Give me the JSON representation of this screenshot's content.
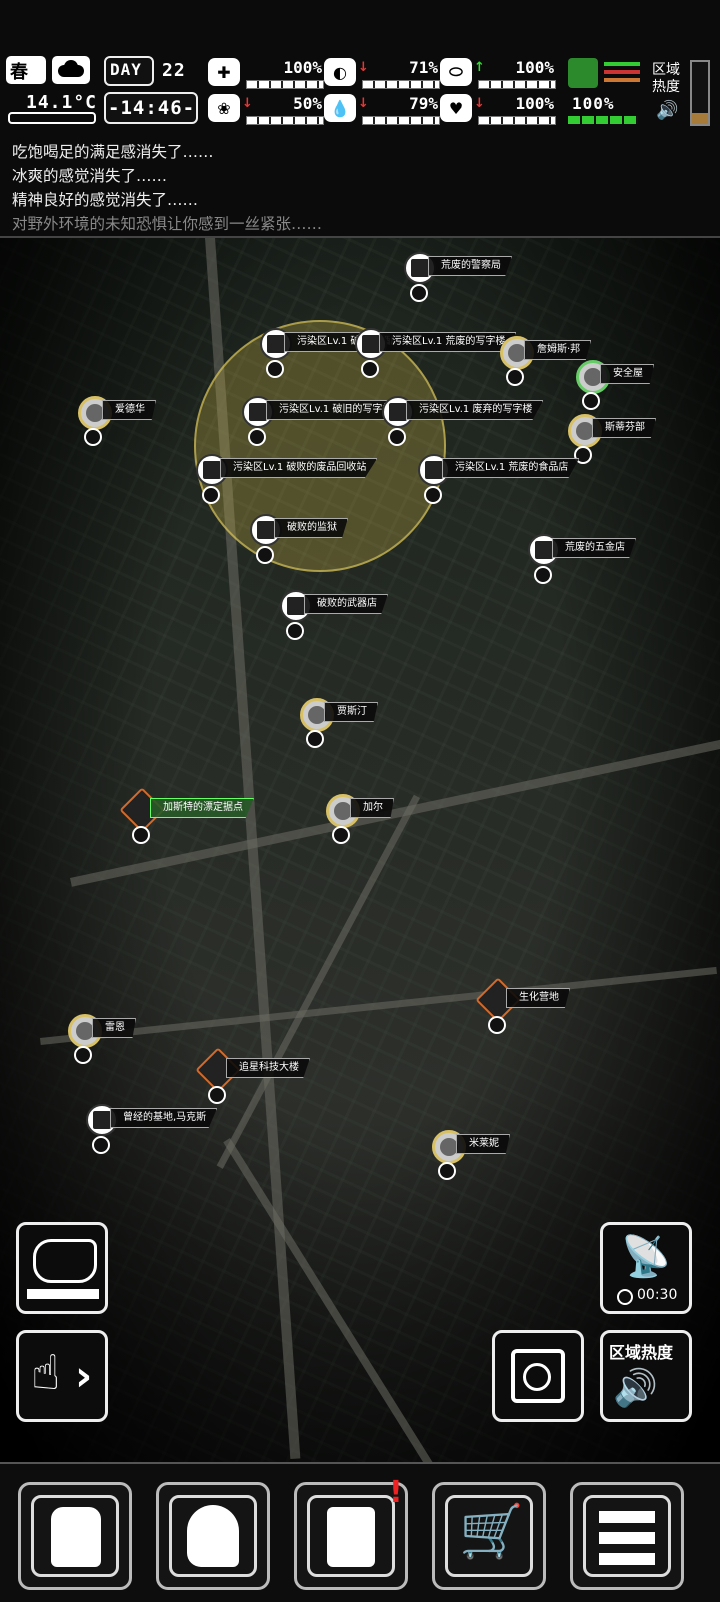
{
  "hud": {
    "season": "春",
    "temperature": "14.1°C",
    "day_label": "DAY",
    "day_number": "22",
    "clock": "-14:46-",
    "stats": [
      {
        "icon": "medkit-icon",
        "value": "100%",
        "level": 1.0
      },
      {
        "icon": "stomach-icon",
        "value": "71%",
        "trend": "down",
        "level": 0.71
      },
      {
        "icon": "bladder-icon",
        "value": "100%",
        "trend": "up",
        "level": 1.0
      },
      {
        "icon": "brain-icon",
        "value": "50%",
        "trend": "down",
        "level": 0.5
      },
      {
        "icon": "water-drop-icon",
        "value": "79%",
        "trend": "down",
        "level": 0.79
      },
      {
        "icon": "heart-icon",
        "value": "100%",
        "trend": "down",
        "level": 1.0
      }
    ],
    "stamina_value": "100%",
    "zone_heat_label": "区域\n热度",
    "zone_heat_line1": "区域",
    "zone_heat_line2": "热度"
  },
  "log": [
    "吃饱喝足的满足感消失了……",
    "冰爽的感觉消失了……",
    "精神良好的感觉消失了……",
    "对野外环境的未知恐惧让你感到一丝紧张……"
  ],
  "map": {
    "pois": [
      {
        "label": "荒废的警察局",
        "kind": "building"
      },
      {
        "label": "污染区Lv.1 破败的酒店",
        "kind": "building"
      },
      {
        "label": "污染区Lv.1 荒废的写字楼",
        "kind": "building"
      },
      {
        "label": "詹姆斯·邦",
        "kind": "npc"
      },
      {
        "label": "安全屋",
        "kind": "npc"
      },
      {
        "label": "爱德华",
        "kind": "npc"
      },
      {
        "label": "污染区Lv.1 破旧的写字楼",
        "kind": "building"
      },
      {
        "label": "污染区Lv.1 废弃的写字楼",
        "kind": "building"
      },
      {
        "label": "斯蒂芬部",
        "kind": "npc"
      },
      {
        "label": "污染区Lv.1 破败的废品回收站",
        "kind": "building"
      },
      {
        "label": "污染区Lv.1 荒废的食品店",
        "kind": "building"
      },
      {
        "label": "破败的监狱",
        "kind": "building"
      },
      {
        "label": "荒废的五金店",
        "kind": "building"
      },
      {
        "label": "破败的武器店",
        "kind": "building"
      },
      {
        "label": "贾斯汀",
        "kind": "npc"
      },
      {
        "label": "加斯特的漂定据点",
        "kind": "hq"
      },
      {
        "label": "加尔",
        "kind": "npc"
      },
      {
        "label": "生化营地",
        "kind": "hq"
      },
      {
        "label": "雷恩",
        "kind": "npc"
      },
      {
        "label": "追星科技大楼",
        "kind": "hq"
      },
      {
        "label": "曾经的基地,马克斯",
        "kind": "building"
      },
      {
        "label": "米莱妮",
        "kind": "npc"
      }
    ],
    "radar_timer": "00:30",
    "zone_heat_button": "区域热度"
  },
  "nav": [
    "backpack-icon",
    "brain-profile-icon",
    "journal-icon",
    "cart-icon",
    "menu-icon"
  ]
}
